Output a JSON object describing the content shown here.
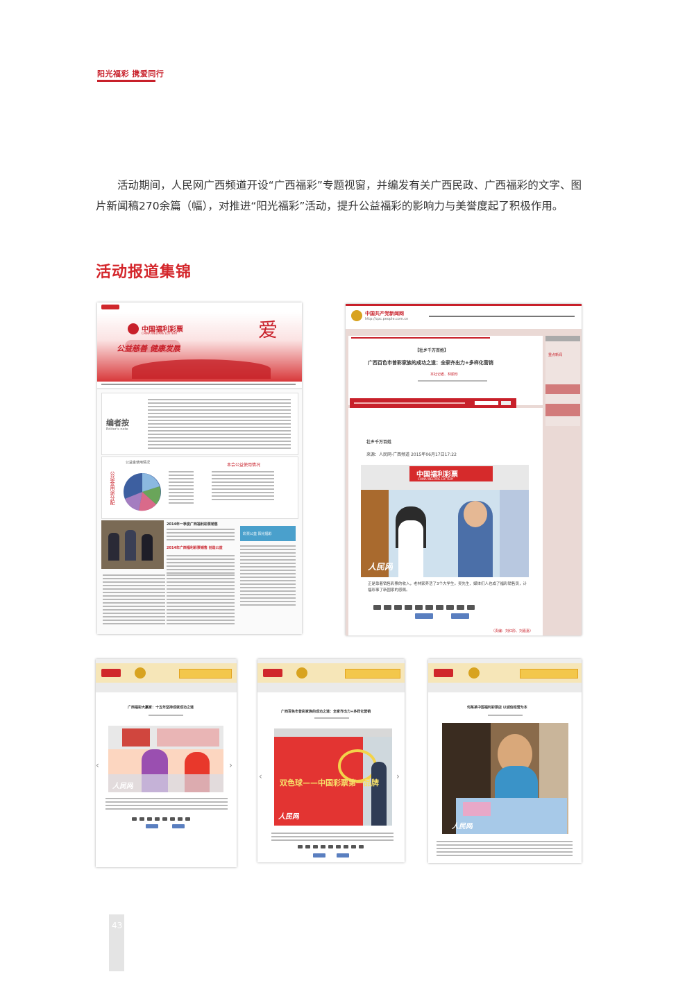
{
  "header": {
    "tagline": "阳光福彩 携爱同行"
  },
  "intro": {
    "text": "活动期间，人民网广西频道开设“广西福彩”专题视窗，并编发有关广西民政、广西福彩的文字、图片新闻稿270余篇（幅），对推进“阳光福彩”活动，提升公益福彩的影响力与美誉度起了积极作用。"
  },
  "section": {
    "title": "活动报道集锦"
  },
  "shot1": {
    "banner_logo": "中国福利彩票",
    "banner_logo_en": "CHINA WELFARE LOTTERY",
    "banner_slogan": "公益慈善  健康发展",
    "banner_ai": "爱",
    "editor_label": "编者按",
    "editor_label_en": "Editor's note",
    "chart_title": "公益金使用情况",
    "table_title": "本会公益使用情况",
    "side_vertical": "公益金用途分配",
    "news_title": "2014年一季度广西福利彩票销售",
    "news_title2": "2014年广西福利彩票销售 创造公益",
    "banner_side": "彩票公益 阳光福彩"
  },
  "shot2": {
    "site_name": "中国共产党新闻网",
    "site_url": "http://cpc.people.com.cn",
    "headline_tag": "【壮乡千万百姓】",
    "headline": "广西百色市曾彩家族的成功之道：全家齐出力+多样化营销",
    "byline": "本社记者、林丽珍",
    "caption_small": "壮乡千万百姓",
    "source": "来源：人民网-广西频道 2015年06月17日17:22",
    "store_sign": "中国福利彩票",
    "store_sign_en": "CHINA WELFARE LOTTERY",
    "watermark": "人民网",
    "caption": "正是靠着销售彩票的收入，老林家养活了3个大学生。吴先生、媒体们人也成了福彩销售员，计福彩事了新国家的感佩。",
    "editor": "（责编：刘红彤、刘嘉嘉）",
    "sidebar_item": "重点新闻"
  },
  "shot3": {
    "headline": "广西福彩大赢家：十五年坚持成就成功之道",
    "watermark": "人民网"
  },
  "shot4": {
    "headline": "广西百色市曾彩家族的成功之道：全家齐出力+多样化营销",
    "banner": "双色球——中国彩票第一品牌",
    "watermark": "人民网"
  },
  "shot5": {
    "headline": "何某某中国福利彩票店 以诚信经营为本",
    "watermark": "人民网"
  },
  "footer": {
    "page_number": "43"
  },
  "colors": {
    "accent": "#c8202a",
    "brand_red": "#d4262b"
  }
}
